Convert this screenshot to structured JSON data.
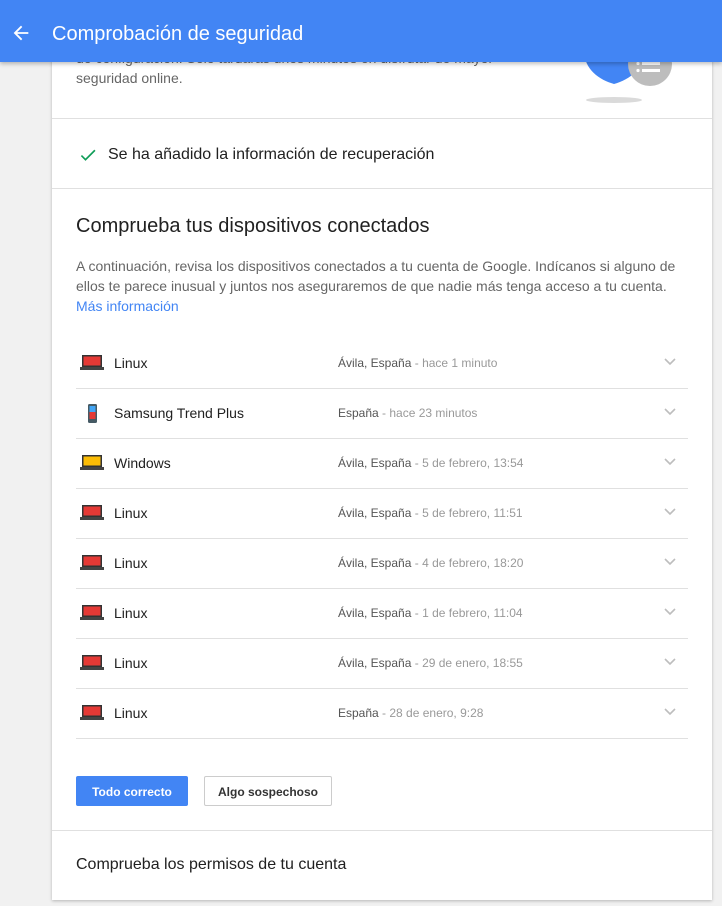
{
  "header": {
    "title": "Comprobación de seguridad"
  },
  "intro": {
    "text": "de configuración. Solo tardarás unos minutos en disfrutar de mayor seguridad online."
  },
  "recovery": {
    "text": "Se ha añadido la información de recuperación"
  },
  "devices_section": {
    "title": "Comprueba tus dispositivos conectados",
    "description": "A continuación, revisa los dispositivos conectados a tu cuenta de Google. Indícanos si alguno de ellos te parece inusual y juntos nos aseguraremos de que nadie más tenga acceso a tu cuenta.",
    "more_link": "Más información",
    "devices": [
      {
        "name": "Linux",
        "location": "Ávila, España",
        "time": "hace 1 minuto",
        "icon": "laptop-red-icon"
      },
      {
        "name": "Samsung Trend Plus",
        "location": "España",
        "time": "hace 23 minutos",
        "icon": "phone-icon"
      },
      {
        "name": "Windows",
        "location": "Ávila, España",
        "time": "5 de febrero, 13:54",
        "icon": "laptop-yellow-icon"
      },
      {
        "name": "Linux",
        "location": "Ávila, España",
        "time": "5 de febrero, 11:51",
        "icon": "laptop-red-icon"
      },
      {
        "name": "Linux",
        "location": "Ávila, España",
        "time": "4 de febrero, 18:20",
        "icon": "laptop-red-icon"
      },
      {
        "name": "Linux",
        "location": "Ávila, España",
        "time": "1 de febrero, 11:04",
        "icon": "laptop-red-icon"
      },
      {
        "name": "Linux",
        "location": "Ávila, España",
        "time": "29 de enero, 18:55",
        "icon": "laptop-red-icon"
      },
      {
        "name": "Linux",
        "location": "España",
        "time": "28 de enero, 9:28",
        "icon": "laptop-red-icon"
      }
    ],
    "separator": " - "
  },
  "actions": {
    "ok_label": "Todo correcto",
    "suspicious_label": "Algo sospechoso"
  },
  "permissions": {
    "title": "Comprueba los permisos de tu cuenta"
  },
  "colors": {
    "accent": "#4285f4",
    "check": "#0f9d58",
    "laptop_red": "#e53935",
    "laptop_yellow": "#fbbc05"
  }
}
